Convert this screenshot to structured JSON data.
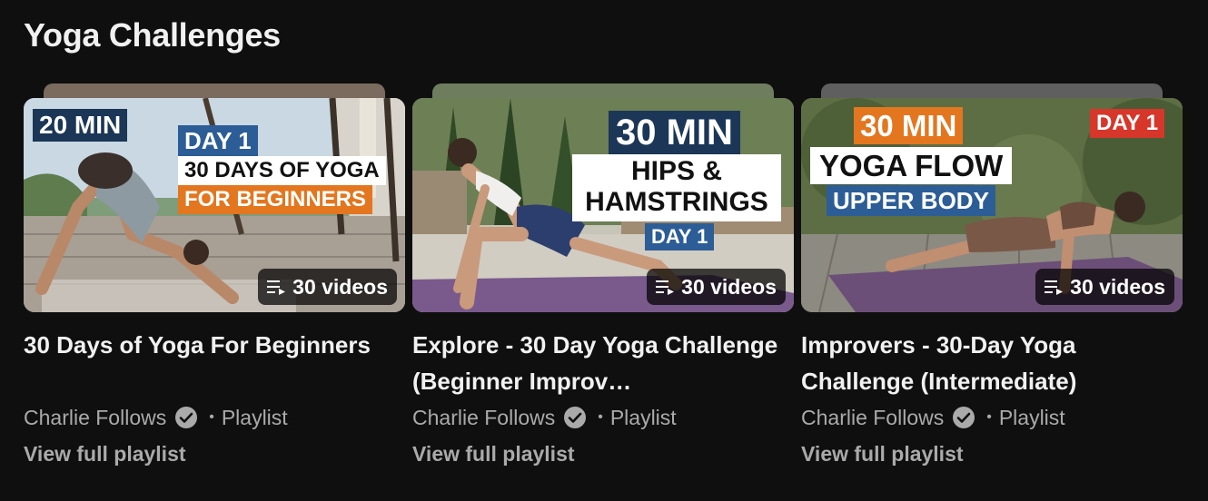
{
  "section": {
    "title": "Yoga Challenges"
  },
  "colors": {
    "background": "#0f0f0f",
    "text_primary": "#f1f1f1",
    "text_secondary": "#aaaaaa",
    "overlay_navy": "#1b3656",
    "overlay_blue": "#2c5d97",
    "overlay_orange": "#e3761f",
    "overlay_red": "#d7362a",
    "mat_purple": "#7a5a8c"
  },
  "playlists": [
    {
      "title": "30 Days of Yoga For Beginners",
      "channel": "Charlie Follows",
      "type": "Playlist",
      "view_link": "View full playlist",
      "video_count": "30 videos",
      "thumb_text": {
        "duration": "20 MIN",
        "day": "DAY 1",
        "line1": "30 DAYS OF YOGA",
        "line2": "FOR BEGINNERS"
      }
    },
    {
      "title": "Explore - 30 Day Yoga Challenge (Beginner Improv…",
      "channel": "Charlie Follows",
      "type": "Playlist",
      "view_link": "View full playlist",
      "video_count": "30 videos",
      "thumb_text": {
        "duration": "30 MIN",
        "line1": "HIPS &",
        "line2": "HAMSTRINGS",
        "day": "DAY 1"
      }
    },
    {
      "title": "Improvers - 30-Day Yoga Challenge (Intermediate)",
      "channel": "Charlie Follows",
      "type": "Playlist",
      "view_link": "View full playlist",
      "video_count": "30 videos",
      "thumb_text": {
        "duration": "30 MIN",
        "day": "DAY 1",
        "line1": "YOGA FLOW",
        "line2": "UPPER BODY"
      }
    }
  ],
  "icons": {
    "count": "playlist-icon",
    "verified": "verified-check-icon"
  }
}
